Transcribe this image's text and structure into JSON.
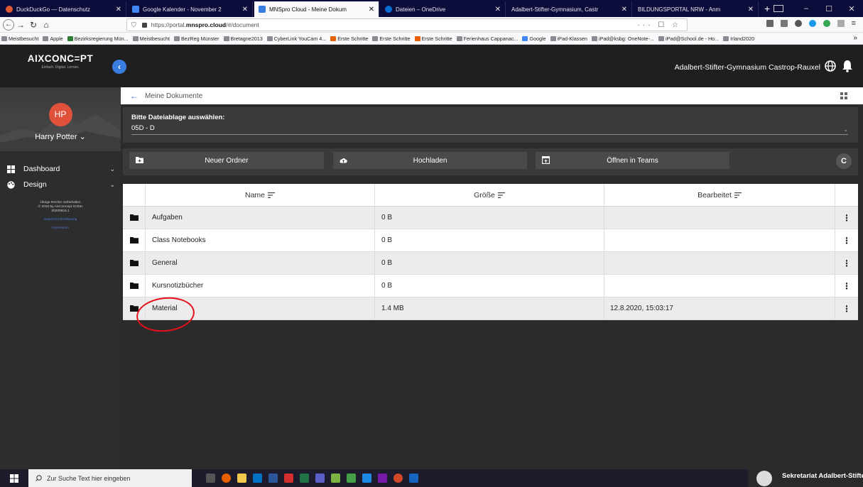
{
  "browser": {
    "tabs": [
      {
        "label": "DuckDuckGo — Datenschutz",
        "fav": "#de5833",
        "active": false
      },
      {
        "label": "Google Kalender - November 2",
        "fav": "#4285f4",
        "active": false
      },
      {
        "label": "MNSpro Cloud - Meine Dokum",
        "fav": "#3a7de0",
        "active": true
      },
      {
        "label": "Dateien – OneDrive",
        "fav": "#0a6ed1",
        "active": false
      },
      {
        "label": "Adalbert-Stifter-Gymnasium, Castr",
        "fav": "#888888",
        "active": false
      },
      {
        "label": "BILDUNGSPORTAL NRW - Anm",
        "fav": "#888888",
        "active": false
      }
    ],
    "url_prefix": "https://portal.",
    "url_domain": "mnspro.cloud",
    "url_path": "/#/document",
    "url_icons": "··· ☐ ☆",
    "bookmarks": [
      "Meistbesucht",
      "Apple",
      "Bezirksregierung Mün...",
      "Meistbesucht",
      "BezReg Münster",
      "Bretagne2013",
      "CyberLink YouCam 4...",
      "Erste Schritte",
      "Erste Schritte",
      "Erste Schritte",
      "Ferienhaus Cappanac...",
      "Google",
      "iPad-Klassen",
      "iPad@ksbg: OneNote-...",
      "iPad@School.de - Ho...",
      "Irland2020"
    ]
  },
  "app": {
    "logo": "AIXCONC=PT",
    "logo_sub": "Einfach. Digital. Lernen.",
    "school": "Adalbert-Stifter-Gymnasium Castrop-Rauxel",
    "user": {
      "initials": "HP",
      "name": "Harry Potter"
    },
    "menu": [
      {
        "label": "Dashboard",
        "icon": "dashboard-icon"
      },
      {
        "label": "Design",
        "icon": "palette-icon"
      }
    ],
    "legal": {
      "line1": "Übrige Rechte vorbehalten",
      "line2": "© 2020 by AixConcept GmbH",
      "line3": "20200916.1",
      "link1": "Datenschutzerklärung",
      "link2": "Impressum"
    },
    "breadcrumb": "Meine Dokumente",
    "storage": {
      "label": "Bitte Dateiablage auswählen:",
      "value": "05D - D"
    },
    "actions": {
      "new_folder": "Neuer Ordner",
      "upload": "Hochladen",
      "open_teams": "Öffnen in Teams"
    },
    "columns": {
      "name": "Name",
      "size": "Größe",
      "edited": "Bearbeitet"
    },
    "rows": [
      {
        "name": "Aufgaben",
        "size": "0 B",
        "edited": ""
      },
      {
        "name": "Class Notebooks",
        "size": "0 B",
        "edited": ""
      },
      {
        "name": "General",
        "size": "0 B",
        "edited": ""
      },
      {
        "name": "Kursnotizbücher",
        "size": "0 B",
        "edited": ""
      },
      {
        "name": "Material",
        "size": "1.4 MB",
        "edited": "12.8.2020, 15:03:17"
      }
    ],
    "row_menu": "⋮"
  },
  "taskbar": {
    "search_placeholder": "Zur Suche Text hier eingeben",
    "notification": "Sekretariat Adalbert-Stifter"
  },
  "colors": {
    "accent": "#3a7de0",
    "annotation": "#e8101a",
    "avatar": "#e0513b"
  }
}
